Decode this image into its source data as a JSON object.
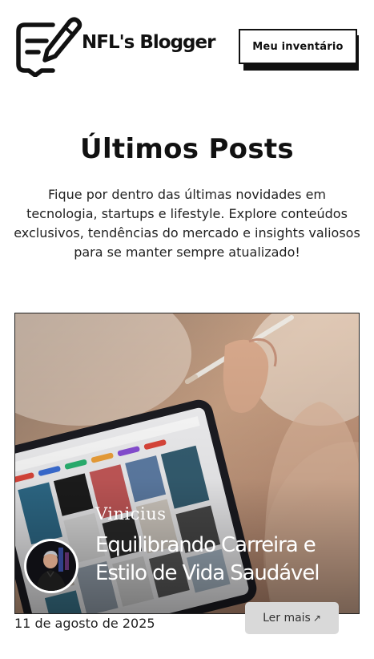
{
  "header": {
    "brand_name": "NFL's Blogger",
    "logo_icon": "chat-pencil-icon",
    "inventory_button_label": "Meu inventário"
  },
  "main": {
    "title": "Últimos Posts",
    "intro": "Fique por dentro das últimas novidades em tecnologia, startups e lifestyle. Explore conteúdos exclusivos, tendências do mercado e insights valiosos para se manter sempre atualizado!"
  },
  "posts": [
    {
      "author": "Vinicius",
      "title": "Equilibrando Carreira e Estilo de Vida Saudável",
      "date": "11 de agosto de 2025",
      "read_more_label": "Ler mais",
      "read_more_icon": "arrow-up-right-icon"
    }
  ],
  "colors": {
    "text": "#111111",
    "button_bg": "#d9d9d9",
    "card_border": "#222222"
  }
}
